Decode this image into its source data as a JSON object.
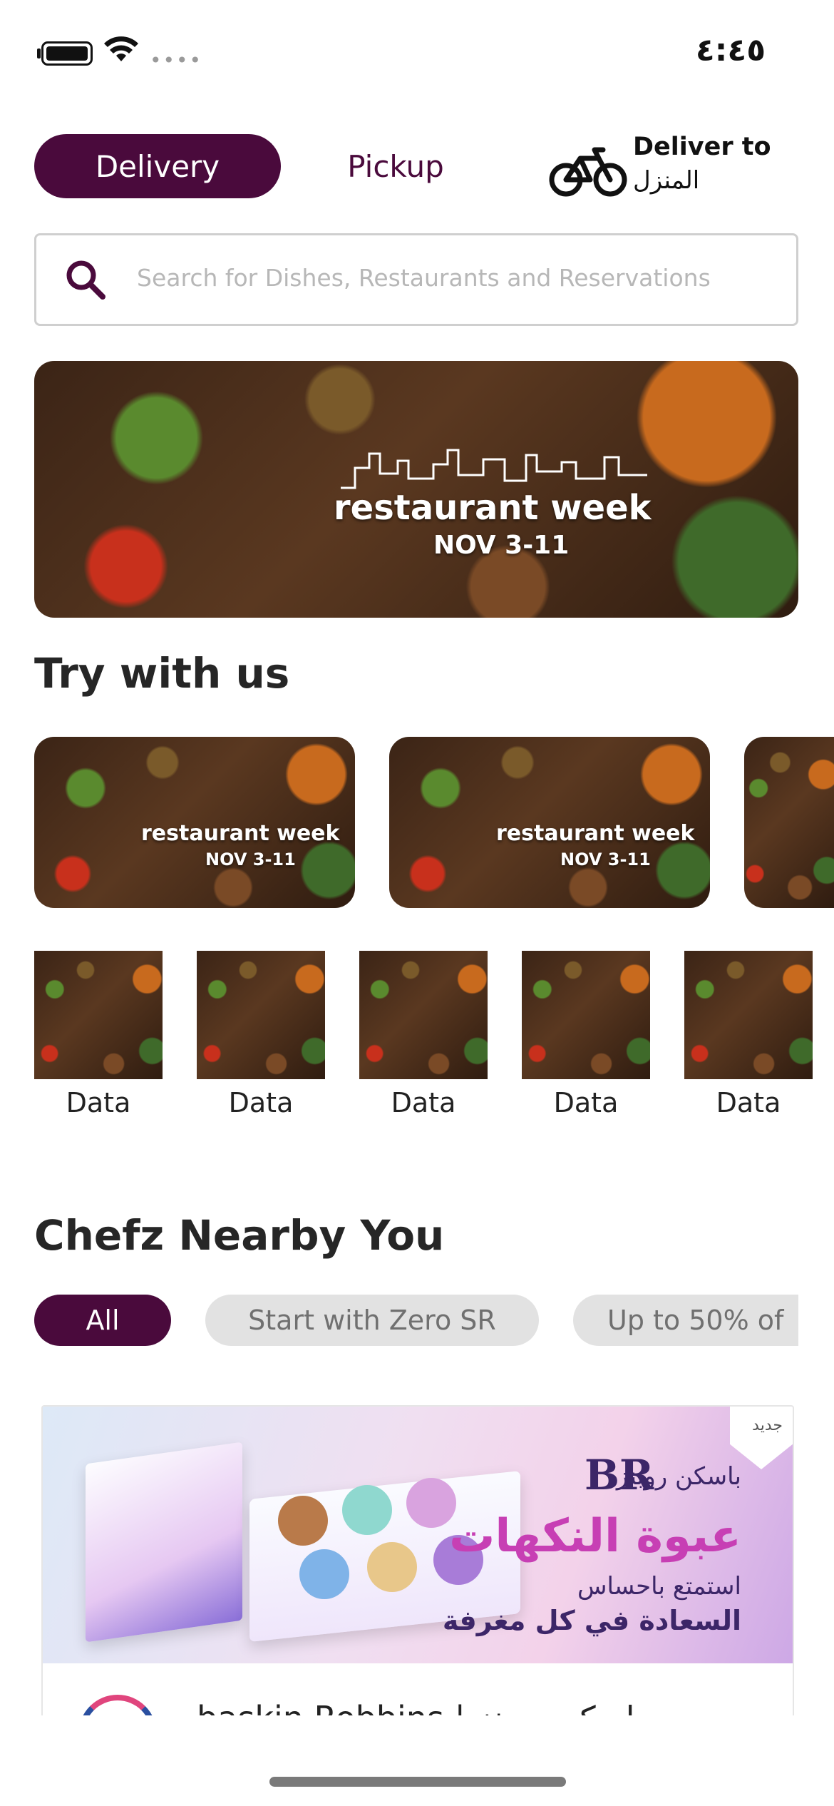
{
  "status_bar": {
    "time": "٤:٤٥"
  },
  "header": {
    "tabs": [
      {
        "label": "Delivery",
        "selected": true
      },
      {
        "label": "Pickup",
        "selected": false
      }
    ],
    "deliver_to_title": "Deliver to",
    "deliver_to_value": "المنزل",
    "accent_color": "#4a0a3c"
  },
  "search": {
    "placeholder": "Search for Dishes, Restaurants and Reservations"
  },
  "hero_banner": {
    "event": "restaurant week",
    "dates": "NOV 3-11"
  },
  "try_with_us": {
    "title": "Try with us",
    "cards": [
      {
        "event": "restaurant week",
        "dates": "NOV 3-11"
      },
      {
        "event": "restaurant week",
        "dates": "NOV 3-11"
      }
    ],
    "thumbnails": [
      {
        "label": "Data"
      },
      {
        "label": "Data"
      },
      {
        "label": "Data"
      },
      {
        "label": "Data"
      },
      {
        "label": "Data"
      }
    ]
  },
  "chefz_nearby": {
    "title": "Chefz Nearby You",
    "filters": [
      {
        "label": "All",
        "selected": true
      },
      {
        "label": "Start with Zero SR",
        "selected": false
      },
      {
        "label": "Up to 50% of",
        "selected": false
      }
    ],
    "restaurant": {
      "banner_brand_ar": "باسكن روبنز",
      "banner_logo": "BR",
      "banner_headline_ar": "عبوة النكهات",
      "banner_line1_ar": "استمتع باحساس",
      "banner_line2_ar": "السعادة في كل مغرفة",
      "name": "baskin Robbins | باسكن روبنز"
    }
  }
}
